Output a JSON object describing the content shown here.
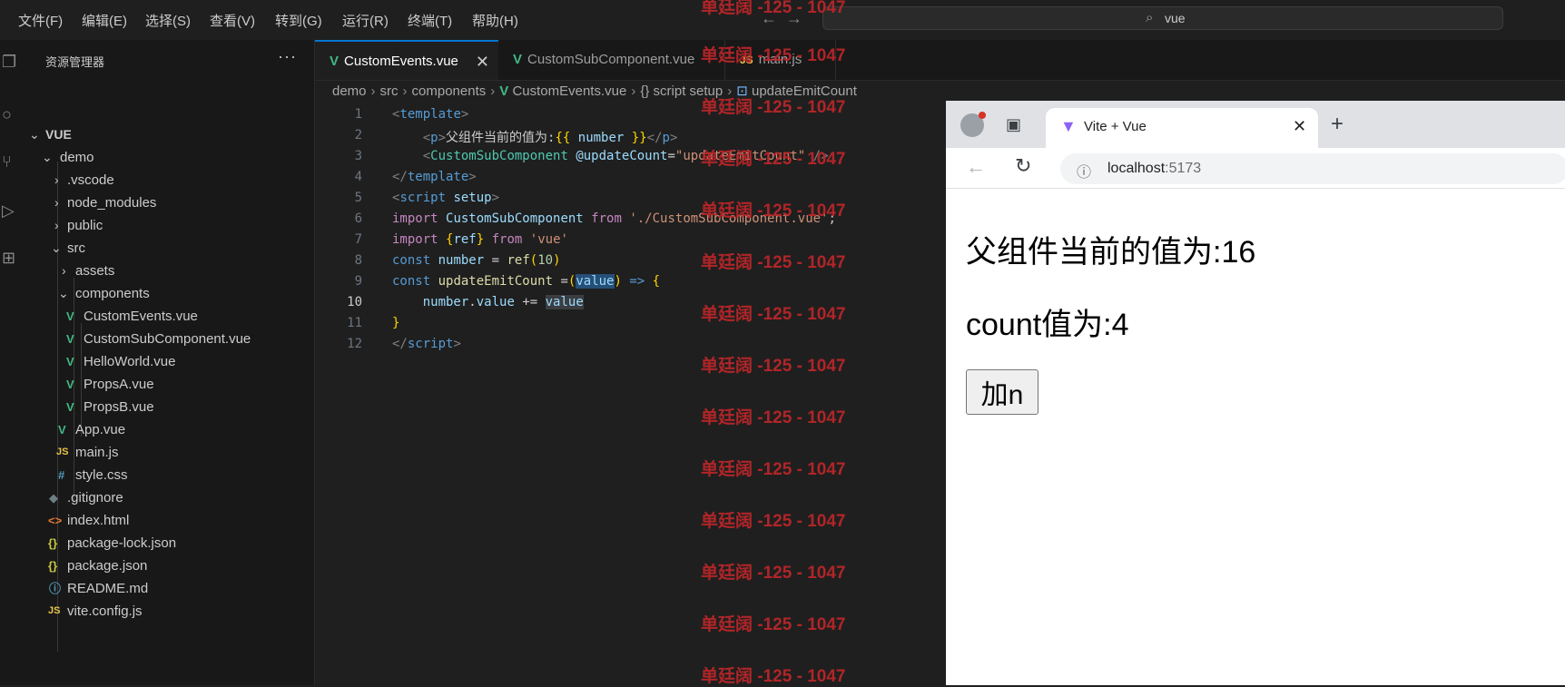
{
  "menu": [
    "文件(F)",
    "编辑(E)",
    "选择(S)",
    "查看(V)",
    "转到(G)",
    "运行(R)",
    "终端(T)",
    "帮助(H)"
  ],
  "search": {
    "text": "vue"
  },
  "sidebar": {
    "title": "资源管理器",
    "more": "···",
    "tree": [
      {
        "label": "VUE",
        "kind": "root"
      },
      {
        "label": "demo",
        "kind": "folder-open"
      },
      {
        "label": ".vscode",
        "kind": "folder"
      },
      {
        "label": "node_modules",
        "kind": "folder"
      },
      {
        "label": "public",
        "kind": "folder"
      },
      {
        "label": "src",
        "kind": "folder-open"
      },
      {
        "label": "assets",
        "kind": "folder"
      },
      {
        "label": "components",
        "kind": "folder-open"
      },
      {
        "label": "CustomEvents.vue",
        "kind": "vue"
      },
      {
        "label": "CustomSubComponent.vue",
        "kind": "vue"
      },
      {
        "label": "HelloWorld.vue",
        "kind": "vue"
      },
      {
        "label": "PropsA.vue",
        "kind": "vue"
      },
      {
        "label": "PropsB.vue",
        "kind": "vue"
      },
      {
        "label": "App.vue",
        "kind": "vue"
      },
      {
        "label": "main.js",
        "kind": "js"
      },
      {
        "label": "style.css",
        "kind": "css"
      },
      {
        "label": ".gitignore",
        "kind": "git"
      },
      {
        "label": "index.html",
        "kind": "html"
      },
      {
        "label": "package-lock.json",
        "kind": "json"
      },
      {
        "label": "package.json",
        "kind": "json"
      },
      {
        "label": "README.md",
        "kind": "md"
      },
      {
        "label": "vite.config.js",
        "kind": "js"
      }
    ]
  },
  "tabs": [
    {
      "label": "CustomEvents.vue",
      "icon": "vue-icon",
      "active": true
    },
    {
      "label": "CustomSubComponent.vue",
      "icon": "vue-icon"
    },
    {
      "label": "main.js",
      "icon": "js-icon"
    }
  ],
  "breadcrumb": [
    "demo",
    "src",
    "components",
    "CustomEvents.vue",
    "script setup",
    "updateEmitCount"
  ],
  "editor": {
    "line_numbers": [
      "1",
      "2",
      "3",
      "4",
      "5",
      "6",
      "7",
      "8",
      "9",
      "10",
      "11",
      "12"
    ],
    "current_line": "10"
  },
  "watermark": "单廷阔 -125 - 1047",
  "browser": {
    "tab_title": "Vite + Vue",
    "url_host": "localhost",
    "url_port": ":5173",
    "page": {
      "line1": "父组件当前的值为:16",
      "line2": "count值为:4",
      "button": "加n"
    }
  },
  "colors": {
    "accent": "#0078d4",
    "vue": "#41b883",
    "watermark": "#c0262a"
  }
}
